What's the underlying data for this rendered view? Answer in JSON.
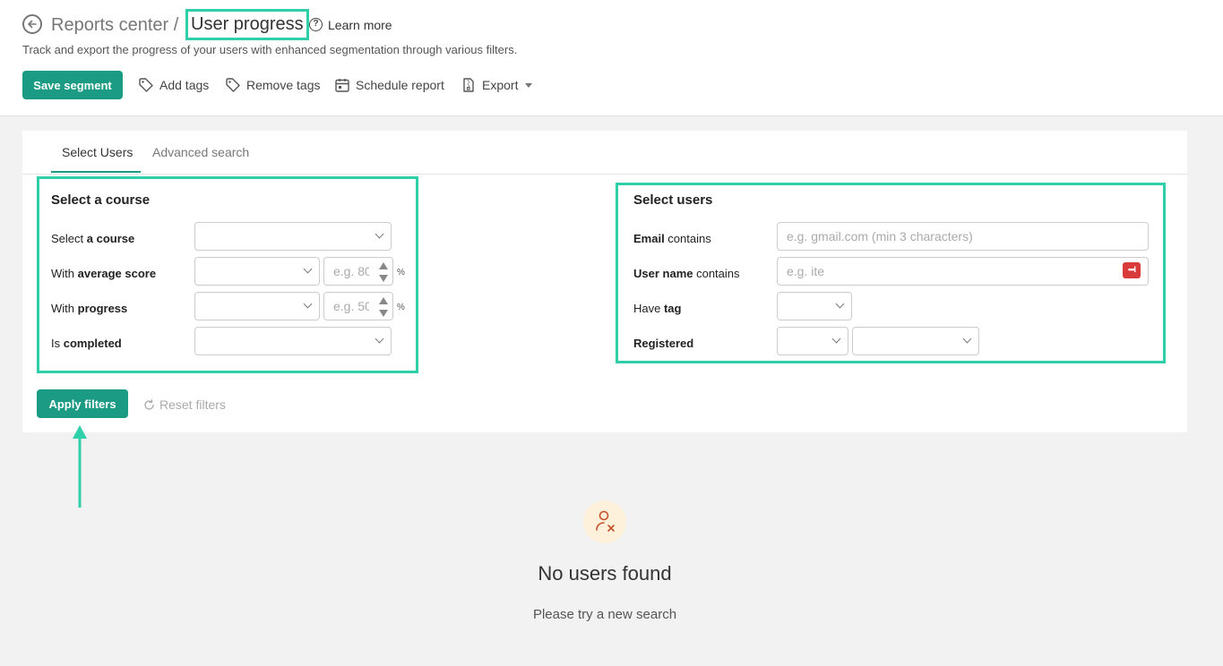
{
  "header": {
    "breadcrumb_parent": "Reports center /",
    "page_title": "User progress",
    "help_icon": "?",
    "learn_more": "Learn more",
    "subtitle": "Track and export the progress of your users with enhanced segmentation through various filters."
  },
  "toolbar": {
    "save_segment": "Save segment",
    "add_tags": "Add tags",
    "remove_tags": "Remove tags",
    "schedule_report": "Schedule report",
    "export": "Export"
  },
  "tabs": {
    "select_users": "Select Users",
    "advanced_search": "Advanced search"
  },
  "course_filters": {
    "title": "Select a course",
    "course_prefix": "Select ",
    "course_bold": "a course",
    "score_prefix": "With ",
    "score_bold": "average score",
    "score_placeholder": "e.g. 80",
    "progress_prefix": "With ",
    "progress_bold": "progress",
    "progress_placeholder": "e.g. 50",
    "percent": "%",
    "completed_prefix": "Is ",
    "completed_bold": "completed"
  },
  "user_filters": {
    "title": "Select users",
    "email_bold": "Email",
    "email_suffix": " contains",
    "email_placeholder": "e.g. gmail.com (min 3 characters)",
    "username_bold": "User name",
    "username_suffix": " contains",
    "username_placeholder": "e.g. ite",
    "password_icon_text": "•••I",
    "tag_prefix": "Have ",
    "tag_bold": "tag",
    "registered_bold": "Registered"
  },
  "actions": {
    "apply_filters": "Apply filters",
    "reset_filters": "Reset filters"
  },
  "empty_state": {
    "title": "No users found",
    "subtitle": "Please try a new search"
  },
  "colors": {
    "primary": "#1b9a84",
    "highlight": "#2ecfa9"
  }
}
